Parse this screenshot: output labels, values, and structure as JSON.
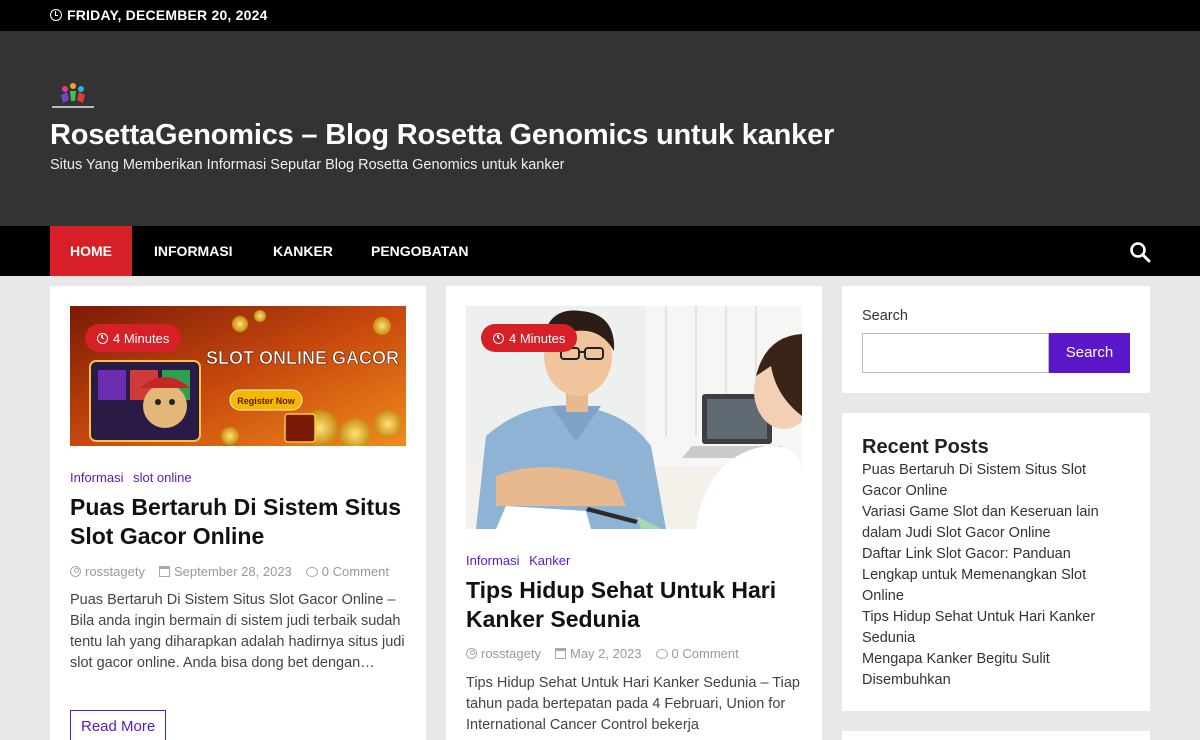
{
  "topbar": {
    "date": "FRIDAY, DECEMBER 20, 2024"
  },
  "site": {
    "title": "RosettaGenomics – Blog Rosetta Genomics untuk kanker",
    "tagline": "Situs Yang Memberikan Informasi Seputar Blog Rosetta Genomics untuk kanker"
  },
  "nav": {
    "items": [
      {
        "label": "HOME"
      },
      {
        "label": "INFORMASI"
      },
      {
        "label": "KANKER"
      },
      {
        "label": "PENGOBATAN"
      }
    ]
  },
  "posts": [
    {
      "read_time": "4 Minutes",
      "image_text": "SLOT ONLINE GACOR",
      "image_button": "Register Now",
      "categories": [
        "Informasi",
        "slot online"
      ],
      "title": "Puas Bertaruh Di Sistem Situs Slot Gacor Online",
      "author": "rosstagety",
      "date": "September 28, 2023",
      "comments": "0 Comment",
      "excerpt": "Puas Bertaruh Di Sistem Situs Slot Gacor Online – Bila anda ingin bermain di sistem judi terbaik sudah tentu lah yang diharapkan adalah hadirnya situs judi slot gacor online. Anda bisa dong bet dengan…",
      "read_more": "Read More"
    },
    {
      "read_time": "4 Minutes",
      "categories": [
        "Informasi",
        "Kanker"
      ],
      "title": "Tips Hidup Sehat Untuk Hari Kanker Sedunia",
      "author": "rosstagety",
      "date": "May 2, 2023",
      "comments": "0 Comment",
      "excerpt": "Tips Hidup Sehat Untuk Hari Kanker Sedunia – Tiap tahun pada bertepatan pada 4 Februari, Union for International Cancer Control bekerja"
    }
  ],
  "sidebar": {
    "search": {
      "label": "Search",
      "button": "Search",
      "value": ""
    },
    "recent": {
      "title": "Recent Posts",
      "items": [
        "Puas Bertaruh Di Sistem Situs Slot Gacor Online",
        "Variasi Game Slot dan Keseruan lain dalam Judi Slot Gacor Online",
        "Daftar Link Slot Gacor: Panduan Lengkap untuk Memenangkan Slot Online",
        "Tips Hidup Sehat Untuk Hari Kanker Sedunia",
        "Mengapa Kanker Begitu Sulit Disembuhkan"
      ]
    }
  },
  "colors": {
    "accent_red": "#d61f26",
    "accent_purple": "#5b16c9",
    "header_bg": "#333333",
    "nav_bg": "#000000"
  }
}
